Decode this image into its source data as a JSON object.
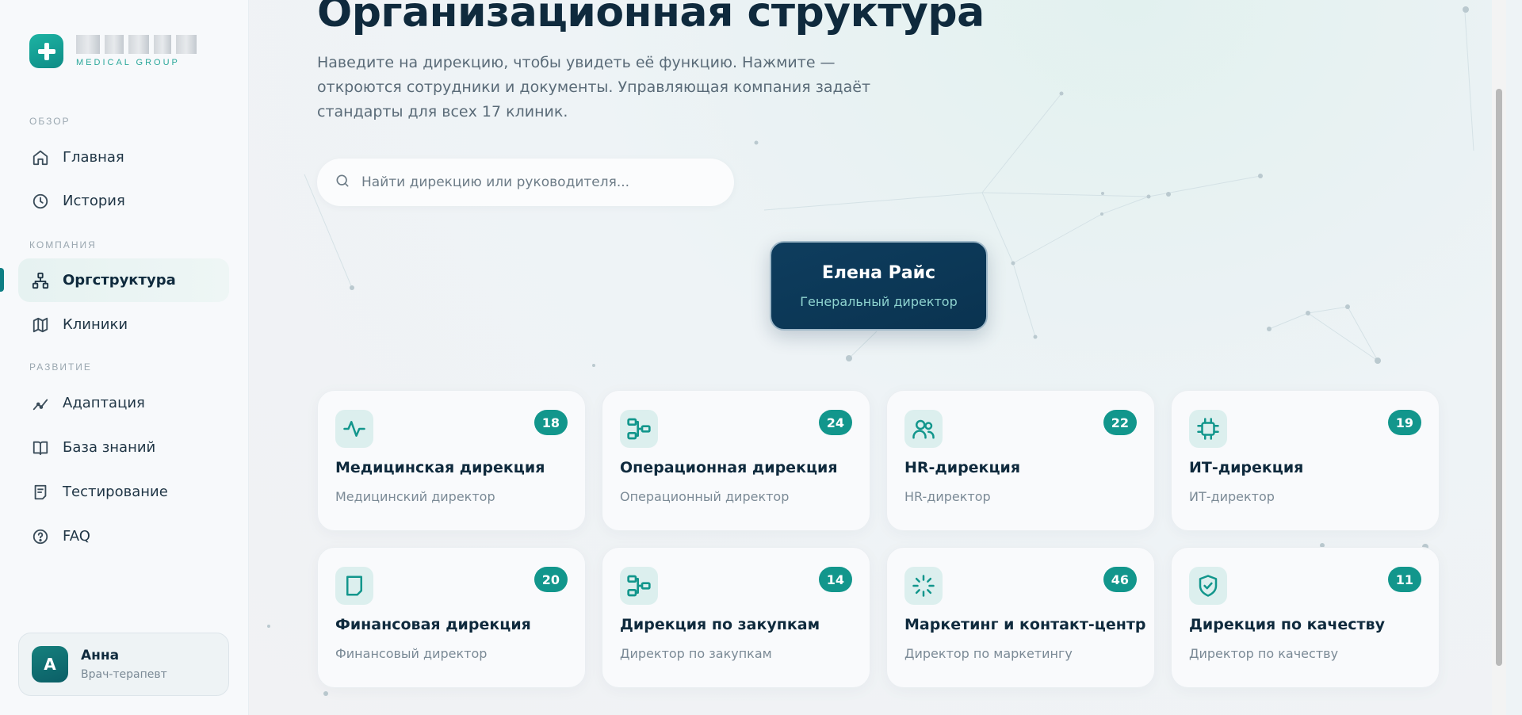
{
  "brand": {
    "subtitle": "MEDICAL GROUP"
  },
  "sidebar": {
    "sections": [
      {
        "label": "ОБЗОР"
      },
      {
        "label": "КОМПАНИЯ"
      },
      {
        "label": "РАЗВИТИЕ"
      }
    ],
    "items": [
      {
        "label": "Главная",
        "icon": "home-icon"
      },
      {
        "label": "История",
        "icon": "clock-icon"
      },
      {
        "label": "Оргструктура",
        "icon": "org-icon",
        "active": true
      },
      {
        "label": "Клиники",
        "icon": "map-icon"
      },
      {
        "label": "Адаптация",
        "icon": "trend-icon"
      },
      {
        "label": "База знаний",
        "icon": "book-icon"
      },
      {
        "label": "Тестирование",
        "icon": "test-icon"
      },
      {
        "label": "FAQ",
        "icon": "help-icon"
      }
    ],
    "user": {
      "initial": "А",
      "name": "Анна",
      "role": "Врач-терапевт"
    }
  },
  "page": {
    "title": "Организационная структура",
    "description": "Наведите на дирекцию, чтобы увидеть её функцию. Нажмите — откроются сотрудники и документы. Управляющая компания задаёт стандарты для всех 17 клиник.",
    "search_placeholder": "Найти дирекцию или руководителя..."
  },
  "ceo": {
    "name": "Елена Райс",
    "title": "Генеральный директор"
  },
  "directorates": [
    {
      "name": "Медицинская дирекция",
      "role": "Медицинский директор",
      "count": "18",
      "icon": "pulse-icon"
    },
    {
      "name": "Операционная дирекция",
      "role": "Операционный директор",
      "count": "24",
      "icon": "workflow-icon"
    },
    {
      "name": "HR-дирекция",
      "role": "HR-директор",
      "count": "22",
      "icon": "users-icon"
    },
    {
      "name": "ИТ-дирекция",
      "role": "ИТ-директор",
      "count": "19",
      "icon": "chip-icon"
    },
    {
      "name": "Финансовая дирекция",
      "role": "Финансовый директор",
      "count": "20",
      "icon": "document-icon"
    },
    {
      "name": "Дирекция по закупкам",
      "role": "Директор по закупкам",
      "count": "14",
      "icon": "workflow-icon"
    },
    {
      "name": "Маркетинг и контакт-центр",
      "role": "Директор по маркетингу",
      "count": "46",
      "icon": "loader-icon"
    },
    {
      "name": "Дирекция по качеству",
      "role": "Директор по качеству",
      "count": "11",
      "icon": "shield-check-icon"
    }
  ],
  "colors": {
    "accent": "#12968c",
    "navy": "#0e3d5e",
    "text": "#0f2a3d"
  }
}
